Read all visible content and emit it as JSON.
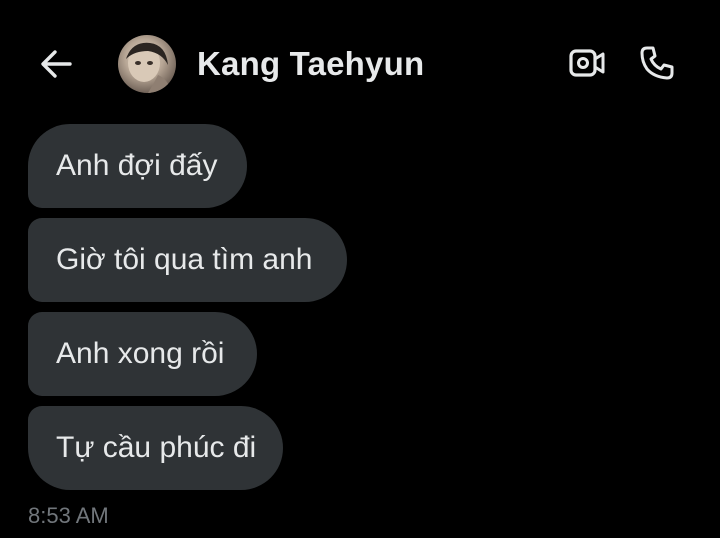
{
  "header": {
    "contact_name": "Kang Taehyun",
    "back_icon": "arrow-left-icon",
    "video_icon": "video-camera-icon",
    "call_icon": "phone-icon"
  },
  "messages": [
    {
      "text": "Anh đợi đấy"
    },
    {
      "text": "Giờ tôi qua tìm anh"
    },
    {
      "text": "Anh xong rồi"
    },
    {
      "text": "Tự cầu phúc đi"
    }
  ],
  "timestamp": "8:53 AM",
  "colors": {
    "background": "#000000",
    "bubble": "#2f3336",
    "text": "#e7e9ea",
    "muted": "#71767b"
  }
}
